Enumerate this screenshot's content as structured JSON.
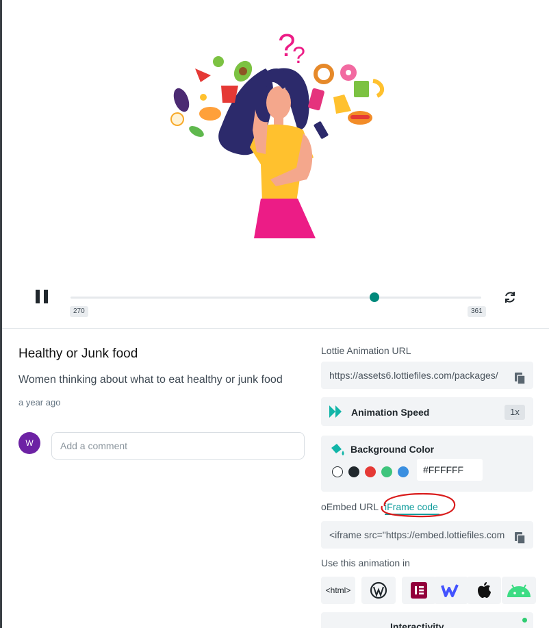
{
  "player": {
    "progress_fraction": 0.74,
    "frame_start": "270",
    "frame_end": "361"
  },
  "animation": {
    "title": "Healthy or Junk food",
    "description": "Women thinking about what to eat healthy or junk food",
    "posted": "a year ago"
  },
  "comment": {
    "avatar_initial": "W",
    "placeholder": "Add a comment"
  },
  "sidebar": {
    "lottie_url_label": "Lottie Animation URL",
    "lottie_url_value": "https://assets6.lottiefiles.com/packages/",
    "speed_label": "Animation Speed",
    "speed_value": "1x",
    "bg_label": "Background Color",
    "bg_hex": "#FFFFFF",
    "swatches": [
      "#ffffff",
      "#20272c",
      "#e53935",
      "#3ec47c",
      "#3a8fe0"
    ],
    "oembed_label": "oEmbed URL",
    "iframe_tab": "iFrame code",
    "iframe_value": "<iframe src=\"https://embed.lottiefiles.com",
    "use_in_label": "Use this animation in",
    "platforms": [
      "<html>",
      "wordpress-icon",
      "elementor-icon",
      "webflow-icon",
      "apple-icon",
      "android-icon"
    ],
    "interactivity_label": "Interactivity"
  },
  "colors": {
    "accent": "#00897b",
    "link": "#0f9c9c",
    "annotation": "#d91c1c"
  }
}
